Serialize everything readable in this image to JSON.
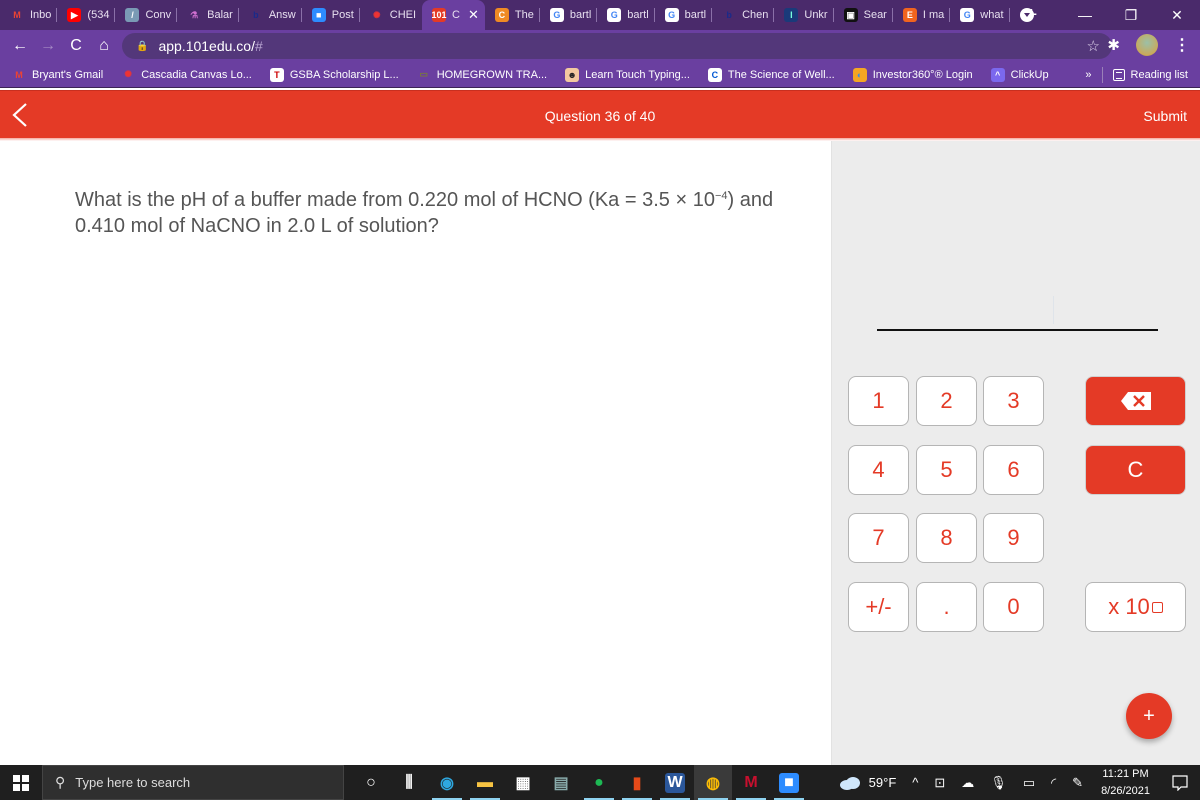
{
  "browser": {
    "tabs": [
      {
        "label": "Inbo",
        "icon": "gmail-icon",
        "fav_bg": "transparent",
        "fav_text": "M",
        "fav_color": "#ea4335"
      },
      {
        "label": "(534",
        "icon": "youtube-icon",
        "fav_bg": "#ff0000",
        "fav_text": "▶",
        "fav_color": "#fff"
      },
      {
        "label": "Conv",
        "icon": "convert-icon",
        "fav_bg": "#7a9ab5",
        "fav_text": "/",
        "fav_color": "#fff"
      },
      {
        "label": "Balar",
        "icon": "flask-icon",
        "fav_bg": "transparent",
        "fav_text": "⚗",
        "fav_color": "#d070d0"
      },
      {
        "label": "Answ",
        "icon": "bartleby-icon",
        "fav_bg": "transparent",
        "fav_text": "b",
        "fav_color": "#1a2a8a"
      },
      {
        "label": "Post",
        "icon": "zoom-icon",
        "fav_bg": "#2d8cff",
        "fav_text": "■",
        "fav_color": "#fff"
      },
      {
        "label": "CHEI",
        "icon": "canvas-icon",
        "fav_bg": "transparent",
        "fav_text": "✺",
        "fav_color": "#e33"
      },
      {
        "label": "C",
        "icon": "101edu-icon",
        "fav_bg": "#e43a26",
        "fav_text": "101",
        "fav_color": "#fff",
        "active": true
      },
      {
        "label": "The",
        "icon": "coursera-icon",
        "fav_bg": "#f08a24",
        "fav_text": "C",
        "fav_color": "#fff"
      },
      {
        "label": "bartl",
        "icon": "google-icon",
        "fav_bg": "#fff",
        "fav_text": "G",
        "fav_color": "#4285f4"
      },
      {
        "label": "bartl",
        "icon": "google-icon",
        "fav_bg": "#fff",
        "fav_text": "G",
        "fav_color": "#4285f4"
      },
      {
        "label": "bartl",
        "icon": "google-icon",
        "fav_bg": "#fff",
        "fav_text": "G",
        "fav_color": "#4285f4"
      },
      {
        "label": "Chen",
        "icon": "bartleby-icon",
        "fav_bg": "transparent",
        "fav_text": "b",
        "fav_color": "#1a2a8a"
      },
      {
        "label": "Unkr",
        "icon": "unknown-site-icon",
        "fav_bg": "#1a3a7a",
        "fav_text": "I",
        "fav_color": "#7fd"
      },
      {
        "label": "Sear",
        "icon": "search-site-icon",
        "fav_bg": "#111",
        "fav_text": "▣",
        "fav_color": "#fff"
      },
      {
        "label": "I ma",
        "icon": "etsy-icon",
        "fav_bg": "#f1641e",
        "fav_text": "E",
        "fav_color": "#fff"
      },
      {
        "label": "what",
        "icon": "google-icon",
        "fav_bg": "#fff",
        "fav_text": "G",
        "fav_color": "#4285f4"
      }
    ],
    "new_tab_label": "+",
    "window_controls": {
      "minimize": "—",
      "restore": "❐",
      "close": "✕"
    },
    "url": "app.101edu.co/",
    "url_fragment": "#",
    "bookmarks": [
      {
        "label": "Bryant's Gmail",
        "icon": "gmail-icon",
        "fav_bg": "transparent",
        "fav_text": "M",
        "fav_color": "#ea4335"
      },
      {
        "label": "Cascadia Canvas Lo...",
        "icon": "canvas-icon",
        "fav_bg": "transparent",
        "fav_text": "✺",
        "fav_color": "#e33"
      },
      {
        "label": "GSBA Scholarship L...",
        "icon": "gsba-icon",
        "fav_bg": "#fff",
        "fav_text": "T",
        "fav_color": "#c00"
      },
      {
        "label": "HOMEGROWN TRA...",
        "icon": "homegrown-icon",
        "fav_bg": "transparent",
        "fav_text": "▭",
        "fav_color": "#7a7a3a"
      },
      {
        "label": "Learn Touch Typing...",
        "icon": "typing-icon",
        "fav_bg": "#f3c9a0",
        "fav_text": "☻",
        "fav_color": "#222"
      },
      {
        "label": "The Science of Well...",
        "icon": "coursera-icon",
        "fav_bg": "#fff",
        "fav_text": "C",
        "fav_color": "#0056d2"
      },
      {
        "label": "Investor360°® Login",
        "icon": "investor360-icon",
        "fav_bg": "#f5a623",
        "fav_text": "◐",
        "fav_color": "#3a8ee6"
      },
      {
        "label": "ClickUp",
        "icon": "clickup-icon",
        "fav_bg": "#7b68ee",
        "fav_text": "^",
        "fav_color": "#fff"
      }
    ],
    "bookmarks_overflow": "»",
    "reading_list": "Reading list"
  },
  "app": {
    "header_title": "Question 36 of 40",
    "submit_label": "Submit",
    "question": {
      "part1": "What is the pH of a buffer made from 0.220 mol of HCNO (Ka = 3.5 × 10",
      "exponent": "−4",
      "part2": ") and 0.410 mol of NaCNO in 2.0 L of solution?"
    },
    "answer_value": "",
    "keypad": {
      "digits": [
        "1",
        "2",
        "3",
        "4",
        "5",
        "6",
        "7",
        "8",
        "9"
      ],
      "plus_minus": "+/-",
      "decimal": ".",
      "zero": "0",
      "clear": "C",
      "sci_notation": "x 10"
    },
    "fab_label": "+",
    "accent_color": "#e43a26"
  },
  "taskbar": {
    "search_placeholder": "Type here to search",
    "apps": [
      {
        "name": "cortana-icon"
      },
      {
        "name": "task-view-icon"
      },
      {
        "name": "edge-icon"
      },
      {
        "name": "file-explorer-icon"
      },
      {
        "name": "microsoft-store-icon"
      },
      {
        "name": "calculator-icon"
      },
      {
        "name": "spotify-icon"
      },
      {
        "name": "office-icon"
      },
      {
        "name": "word-icon"
      },
      {
        "name": "chrome-icon"
      },
      {
        "name": "mcafee-icon"
      },
      {
        "name": "zoom-app-icon"
      }
    ],
    "weather": "59°F",
    "time": "11:21 PM",
    "date": "8/26/2021"
  }
}
